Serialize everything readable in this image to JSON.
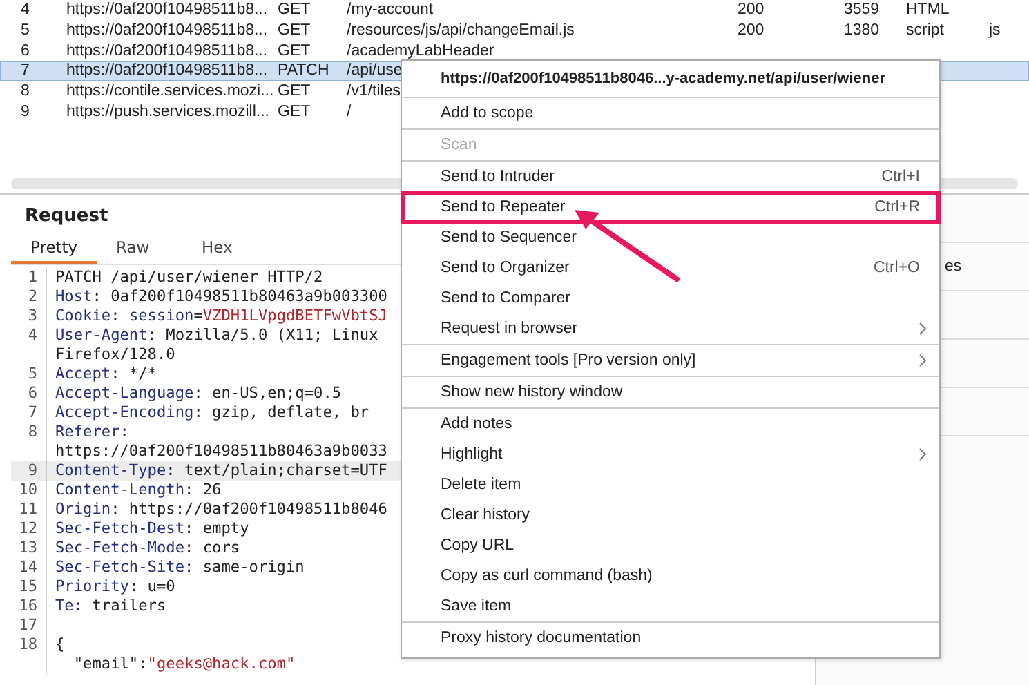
{
  "history_table": {
    "rows": [
      {
        "number": "4",
        "host": "https://0af200f10498511b8...",
        "method": "GET",
        "url": "/my-account",
        "status": "200",
        "length": "3559",
        "mime": "HTML",
        "extension": "",
        "selected": false
      },
      {
        "number": "5",
        "host": "https://0af200f10498511b8...",
        "method": "GET",
        "url": "/resources/js/api/changeEmail.js",
        "status": "200",
        "length": "1380",
        "mime": "script",
        "extension": "js",
        "selected": false
      },
      {
        "number": "6",
        "host": "https://0af200f10498511b8...",
        "method": "GET",
        "url": "/academyLabHeader",
        "status": "",
        "length": "",
        "mime": "",
        "extension": "",
        "selected": false
      },
      {
        "number": "7",
        "host": "https://0af200f10498511b8...",
        "method": "PATCH",
        "url": "/api/use",
        "status": "",
        "length": "",
        "mime": "",
        "extension": "",
        "selected": true
      },
      {
        "number": "8",
        "host": "https://contile.services.mozi...",
        "method": "GET",
        "url": "/v1/tiles",
        "status": "",
        "length": "",
        "mime": "",
        "extension": "",
        "selected": false
      },
      {
        "number": "9",
        "host": "https://push.services.mozill...",
        "method": "GET",
        "url": "/",
        "status": "",
        "length": "",
        "mime": "",
        "extension": "",
        "selected": false
      }
    ]
  },
  "request": {
    "title": "Request",
    "tabs": [
      {
        "label": "Pretty",
        "selected": true
      },
      {
        "label": "Raw",
        "selected": false
      },
      {
        "label": "Hex",
        "selected": false
      }
    ],
    "lines": [
      {
        "number": "1",
        "current": false,
        "parts": [
          {
            "kind": "plain",
            "text": "PATCH /api/user/wiener HTTP/2"
          }
        ]
      },
      {
        "number": "2",
        "current": false,
        "parts": [
          {
            "kind": "key",
            "text": "Host"
          },
          {
            "kind": "plain",
            "text": ": 0af200f10498511b80463a9b003300"
          }
        ]
      },
      {
        "number": "3",
        "current": false,
        "parts": [
          {
            "kind": "key",
            "text": "Cookie"
          },
          {
            "kind": "plain",
            "text": ": "
          },
          {
            "kind": "key",
            "text": "session"
          },
          {
            "kind": "plain",
            "text": "="
          },
          {
            "kind": "string",
            "text": "VZDH1LVpgdBETFwVbtSJ"
          }
        ]
      },
      {
        "number": "4",
        "current": false,
        "parts": [
          {
            "kind": "key",
            "text": "User-Agent"
          },
          {
            "kind": "plain",
            "text": ": Mozilla/5.0 (X11; Linux"
          }
        ]
      },
      {
        "current": false,
        "parts": [
          {
            "kind": "plain",
            "text": "Firefox/128.0"
          }
        ]
      },
      {
        "number": "5",
        "current": false,
        "parts": [
          {
            "kind": "key",
            "text": "Accept"
          },
          {
            "kind": "plain",
            "text": ": */*"
          }
        ]
      },
      {
        "number": "6",
        "current": false,
        "parts": [
          {
            "kind": "key",
            "text": "Accept-Language"
          },
          {
            "kind": "plain",
            "text": ": en-US,en;q=0.5"
          }
        ]
      },
      {
        "number": "7",
        "current": false,
        "parts": [
          {
            "kind": "key",
            "text": "Accept-Encoding"
          },
          {
            "kind": "plain",
            "text": ": gzip, deflate, br"
          }
        ]
      },
      {
        "number": "8",
        "current": false,
        "parts": [
          {
            "kind": "key",
            "text": "Referer"
          },
          {
            "kind": "plain",
            "text": ":"
          }
        ]
      },
      {
        "current": false,
        "parts": [
          {
            "kind": "plain",
            "text": "https://0af200f10498511b80463a9b0033"
          }
        ]
      },
      {
        "number": "9",
        "current": true,
        "parts": [
          {
            "kind": "key",
            "text": "Content-Type"
          },
          {
            "kind": "plain",
            "text": ": text/plain;charset=UTF"
          }
        ]
      },
      {
        "number": "10",
        "current": false,
        "parts": [
          {
            "kind": "key",
            "text": "Content-Length"
          },
          {
            "kind": "plain",
            "text": ": 26"
          }
        ]
      },
      {
        "number": "11",
        "current": false,
        "parts": [
          {
            "kind": "key",
            "text": "Origin"
          },
          {
            "kind": "plain",
            "text": ": https://0af200f10498511b8046"
          }
        ]
      },
      {
        "number": "12",
        "current": false,
        "parts": [
          {
            "kind": "key",
            "text": "Sec-Fetch-Dest"
          },
          {
            "kind": "plain",
            "text": ": empty"
          }
        ]
      },
      {
        "number": "13",
        "current": false,
        "parts": [
          {
            "kind": "key",
            "text": "Sec-Fetch-Mode"
          },
          {
            "kind": "plain",
            "text": ": cors"
          }
        ]
      },
      {
        "number": "14",
        "current": false,
        "parts": [
          {
            "kind": "key",
            "text": "Sec-Fetch-Site"
          },
          {
            "kind": "plain",
            "text": ": same-origin"
          }
        ]
      },
      {
        "number": "15",
        "current": false,
        "parts": [
          {
            "kind": "key",
            "text": "Priority"
          },
          {
            "kind": "plain",
            "text": ": u=0"
          }
        ]
      },
      {
        "number": "16",
        "current": false,
        "parts": [
          {
            "kind": "key",
            "text": "Te"
          },
          {
            "kind": "plain",
            "text": ": trailers"
          }
        ]
      },
      {
        "number": "17",
        "current": false
      },
      {
        "number": "18",
        "current": false,
        "parts": [
          {
            "kind": "plain",
            "text": "{"
          }
        ]
      },
      {
        "current": false,
        "parts": [
          {
            "kind": "plain",
            "text": "  \"email\":"
          },
          {
            "kind": "string",
            "text": "\"geeks@hack.com\""
          }
        ]
      }
    ]
  },
  "side_panel": {
    "text": "es"
  },
  "context_menu": {
    "header": "https://0af200f10498511b8046...y-academy.net/api/user/wiener",
    "groups": [
      [
        {
          "label": "Add to scope",
          "disabled": false,
          "submenu": false,
          "annotated": false
        }
      ],
      [
        {
          "label": "Scan",
          "disabled": true,
          "submenu": false,
          "annotated": false
        }
      ],
      [
        {
          "label": "Send to Intruder",
          "shortcut": "Ctrl+I",
          "disabled": false,
          "submenu": false,
          "annotated": false
        },
        {
          "label": "Send to Repeater",
          "shortcut": "Ctrl+R",
          "disabled": false,
          "submenu": false,
          "annotated": true
        },
        {
          "label": "Send to Sequencer",
          "disabled": false,
          "submenu": false,
          "annotated": false
        },
        {
          "label": "Send to Organizer",
          "shortcut": "Ctrl+O",
          "disabled": false,
          "submenu": false,
          "annotated": false
        },
        {
          "label": "Send to Comparer",
          "disabled": false,
          "submenu": false,
          "annotated": false
        },
        {
          "label": "Request in browser",
          "disabled": false,
          "submenu": true,
          "annotated": false
        }
      ],
      [
        {
          "label": "Engagement tools [Pro version only]",
          "disabled": false,
          "submenu": true,
          "annotated": false
        }
      ],
      [
        {
          "label": "Show new history window",
          "disabled": false,
          "submenu": false,
          "annotated": false
        }
      ],
      [
        {
          "label": "Add notes",
          "disabled": false,
          "submenu": false,
          "annotated": false
        },
        {
          "label": "Highlight",
          "disabled": false,
          "submenu": true,
          "annotated": false
        },
        {
          "label": "Delete item",
          "disabled": false,
          "submenu": false,
          "annotated": false
        },
        {
          "label": "Clear history",
          "disabled": false,
          "submenu": false,
          "annotated": false
        },
        {
          "label": "Copy URL",
          "disabled": false,
          "submenu": false,
          "annotated": false
        },
        {
          "label": "Copy as curl command (bash)",
          "disabled": false,
          "submenu": false,
          "annotated": false
        },
        {
          "label": "Save item",
          "disabled": false,
          "submenu": false,
          "annotated": false
        }
      ],
      [
        {
          "label": "Proxy history documentation",
          "disabled": false,
          "submenu": false,
          "annotated": false
        }
      ]
    ]
  }
}
